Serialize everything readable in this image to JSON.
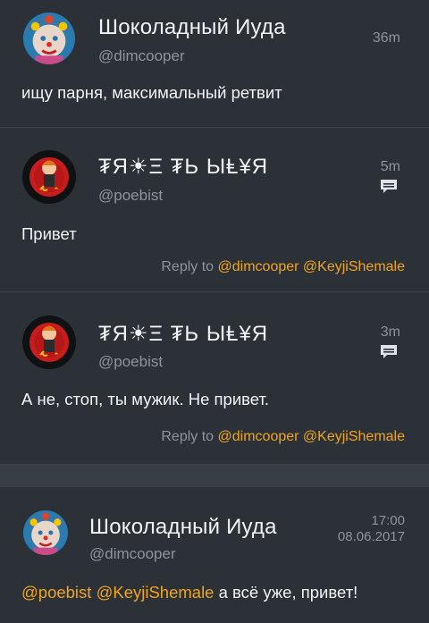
{
  "tweets": [
    {
      "author_name": "Шоколадный Иуда",
      "handle": "@dimcooper",
      "time": "36m",
      "text": "ищу парня, максимальный ретвит"
    },
    {
      "author_name": "₮Я☀Ξ ₮Ь ЫⱠ¥Я",
      "handle": "@poebist",
      "time": "5m",
      "text": "Привет",
      "reply_prefix": "Reply to",
      "reply_mentions": [
        "@dimcooper",
        "@KeyjiShemale"
      ]
    },
    {
      "author_name": "₮Я☀Ξ ₮Ь ЫⱠ¥Я",
      "handle": "@poebist",
      "time": "3m",
      "text": "А не, стоп, ты мужик. Не привет.",
      "reply_prefix": "Reply to",
      "reply_mentions": [
        "@dimcooper",
        "@KeyjiShemale"
      ]
    },
    {
      "author_name": "Шоколадный Иуда",
      "handle": "@dimcooper",
      "time": "17:00",
      "date": "08.06.2017",
      "mentions": [
        "@poebist",
        "@KeyjiShemale"
      ],
      "text": "а всё уже, привет!"
    }
  ],
  "icons": {
    "reply": "reply-icon"
  },
  "colors": {
    "background": "#2c3138",
    "mention": "#f0a51d",
    "muted": "#8c949c"
  }
}
